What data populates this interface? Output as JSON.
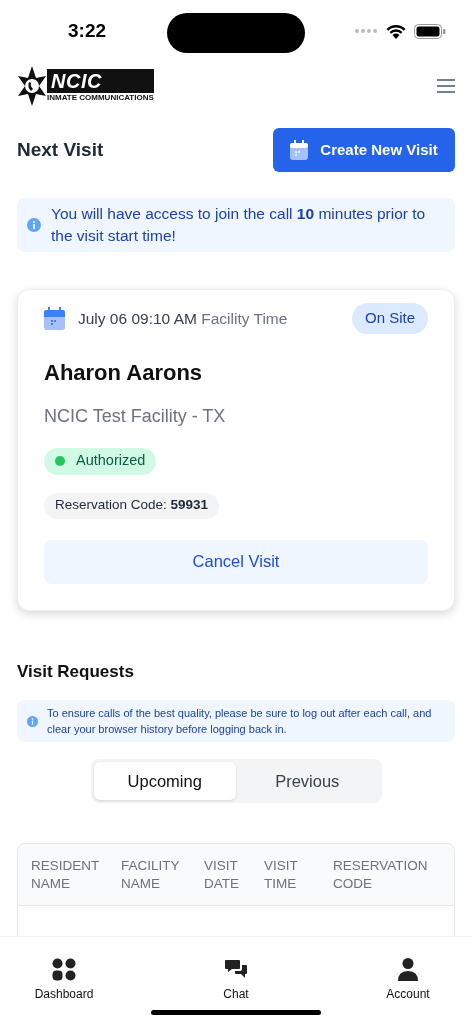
{
  "status_bar": {
    "time": "3:22"
  },
  "logo": {
    "wordmark": "NCIC",
    "tagline": "INMATE COMMUNICATIONS"
  },
  "next_visit": {
    "title": "Next Visit",
    "create_button": "Create New Visit",
    "notice": "You will have access to join the call **10** minutes prior to the visit start time!",
    "card": {
      "date": "July 06 09:10 AM",
      "time_zone": "Facility Time",
      "badge": "On Site",
      "resident": "Aharon Aarons",
      "facility": "NCIC Test Facility - TX",
      "status": {
        "label": "Authorized",
        "color": "#22c55e"
      },
      "reservation": "Reservation Code: **59931**",
      "cancel_button": "Cancel Visit"
    }
  },
  "visit_requests": {
    "title": "Visit Requests",
    "notice": "To ensure calls of the best quality, please be sure to log out after each call, and clear your browser history before logging back in.",
    "tabs": [
      {
        "label": "Upcoming",
        "selected": true
      },
      {
        "label": "Previous",
        "selected": false
      }
    ],
    "table": {
      "columns": [
        "RESIDENT NAME",
        "FACILITY NAME",
        "VISIT DATE",
        "VISIT TIME",
        "RESERVATION CODE"
      ]
    }
  },
  "bottom_nav": [
    {
      "label": "Dashboard",
      "kind": "grid"
    },
    {
      "label": "Chat",
      "kind": "chat"
    },
    {
      "label": "Account",
      "kind": "person"
    }
  ]
}
